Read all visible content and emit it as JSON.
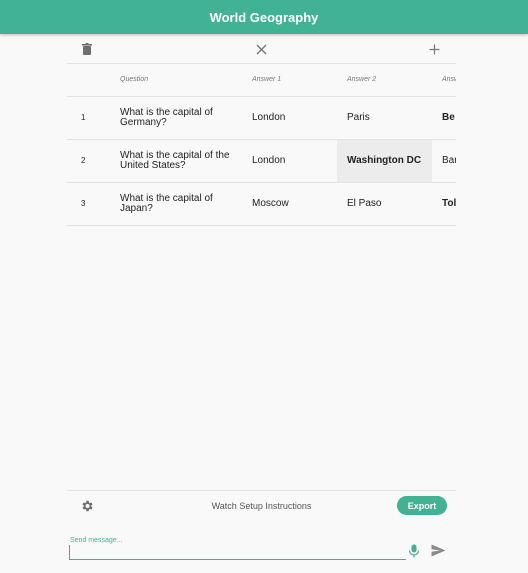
{
  "header": {
    "title": "World Geography"
  },
  "toolbar": {
    "delete_icon": "trash-icon",
    "clear_icon": "close-icon",
    "add_icon": "plus-icon"
  },
  "table": {
    "columns": [
      "",
      "Question",
      "Answer 1",
      "Answer 2",
      "Answ"
    ],
    "rows": [
      {
        "index": "1",
        "question": "What is the capital of Germany?",
        "answer1": "London",
        "answer2": "Paris",
        "answer3": "Be"
      },
      {
        "index": "2",
        "question": "What is the capital of the United States?",
        "answer1": "London",
        "answer2": "Washington DC",
        "answer3": "Bar"
      },
      {
        "index": "3",
        "question": "What is the capital of Japan?",
        "answer1": "Moscow",
        "answer2": "El Paso",
        "answer3": "Tol"
      }
    ]
  },
  "footer": {
    "watch_label": "Watch Setup Instructions",
    "export_label": "Export"
  },
  "message": {
    "label": "Send message...",
    "value": ""
  },
  "colors": {
    "accent": "#42b295",
    "header_text": "#ffffff",
    "selected_cell": "#ececec"
  }
}
